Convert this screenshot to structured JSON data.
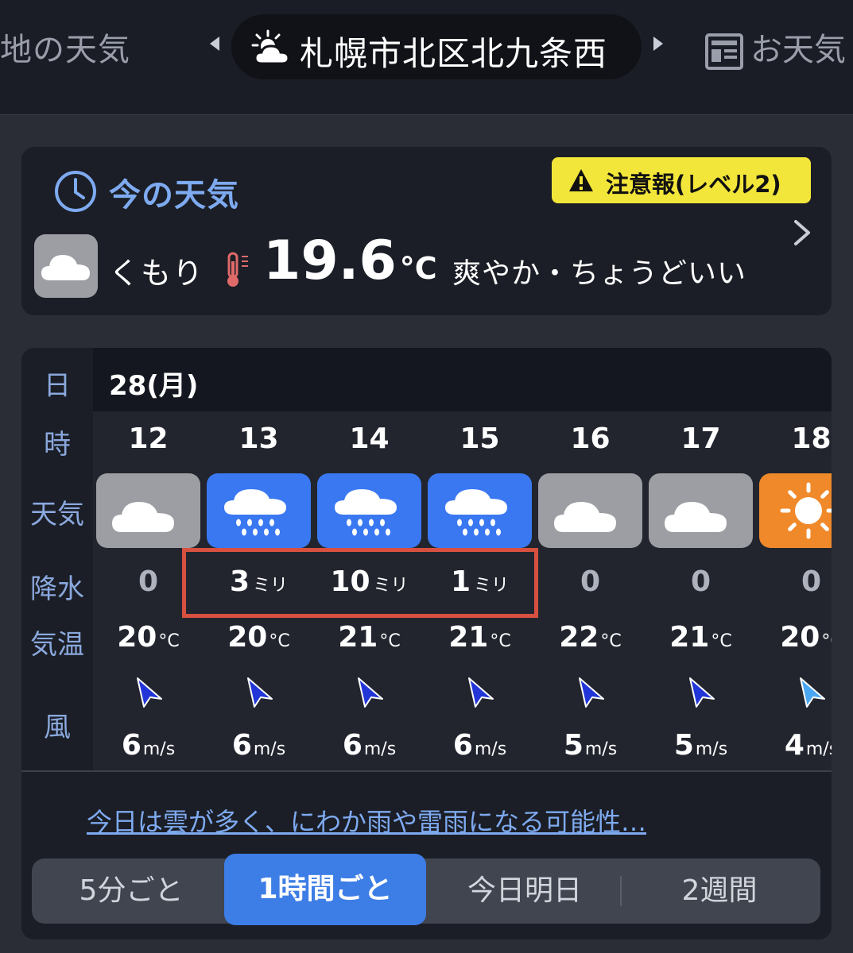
{
  "topbar": {
    "left_text": "地の天気",
    "current_location": "札幌市北区北九条西",
    "right_text": "お天気",
    "icons": {
      "location": "sun-behind-cloud-icon",
      "right": "news-doc-icon",
      "prev": "caret-left-icon",
      "next": "caret-right-icon"
    }
  },
  "now": {
    "title": "今の天気",
    "alert": "注意報(レベル2)",
    "condition": "くもり",
    "temperature": "19.6",
    "temp_unit": "°C",
    "feeling": "爽やか・ちょうどいい",
    "icons": {
      "title": "clock-icon",
      "alert": "warning-icon",
      "condition": "cloud-icon",
      "temp": "thermometer-icon",
      "more": "chevron-right-icon"
    }
  },
  "hourly": {
    "labels": {
      "day": "日",
      "hour": "時",
      "weather": "天気",
      "precip": "降水",
      "temp": "気温",
      "wind": "風"
    },
    "day": "28(月)",
    "hours": [
      {
        "hour": "12",
        "weather": "cloudy",
        "precip": "0",
        "precip_unit": "",
        "temp": "20",
        "temp_unit": "°C",
        "wind": "6",
        "wind_unit": "m/s"
      },
      {
        "hour": "13",
        "weather": "rain",
        "precip": "3",
        "precip_unit": "ミリ",
        "temp": "20",
        "temp_unit": "°C",
        "wind": "6",
        "wind_unit": "m/s"
      },
      {
        "hour": "14",
        "weather": "rain",
        "precip": "10",
        "precip_unit": "ミリ",
        "temp": "21",
        "temp_unit": "°C",
        "wind": "6",
        "wind_unit": "m/s"
      },
      {
        "hour": "15",
        "weather": "rain",
        "precip": "1",
        "precip_unit": "ミリ",
        "temp": "21",
        "temp_unit": "°C",
        "wind": "6",
        "wind_unit": "m/s"
      },
      {
        "hour": "16",
        "weather": "cloudy",
        "precip": "0",
        "precip_unit": "",
        "temp": "22",
        "temp_unit": "°C",
        "wind": "5",
        "wind_unit": "m/s"
      },
      {
        "hour": "17",
        "weather": "cloudy",
        "precip": "0",
        "precip_unit": "",
        "temp": "21",
        "temp_unit": "°C",
        "wind": "5",
        "wind_unit": "m/s"
      },
      {
        "hour": "18",
        "weather": "sunny",
        "precip": "0",
        "precip_unit": "",
        "temp": "20",
        "temp_unit": "°C",
        "wind": "4",
        "wind_unit": "m/s"
      }
    ],
    "summary": "今日は雲が多く、にわか雨や雷雨になる可能性…"
  },
  "tabs": {
    "five_min": "5分ごと",
    "hourly": "1時間ごと",
    "today_tomorrow": "今日明日",
    "two_weeks": "2週間",
    "active": "1時間ごと"
  },
  "colors": {
    "background": "#2a2d36",
    "card": "#1b1e26",
    "accent_blue": "#3d7de6",
    "link_blue": "#7eaaf0",
    "rain_tile": "#3a78f2",
    "cloud_tile": "#9c9ea3",
    "sun_tile": "#f0892a",
    "alert_yellow": "#f3e63a",
    "highlight_red": "#d8503f",
    "wind_arrow_strong": "#2236d8",
    "wind_arrow_light": "#4aa6f0"
  }
}
